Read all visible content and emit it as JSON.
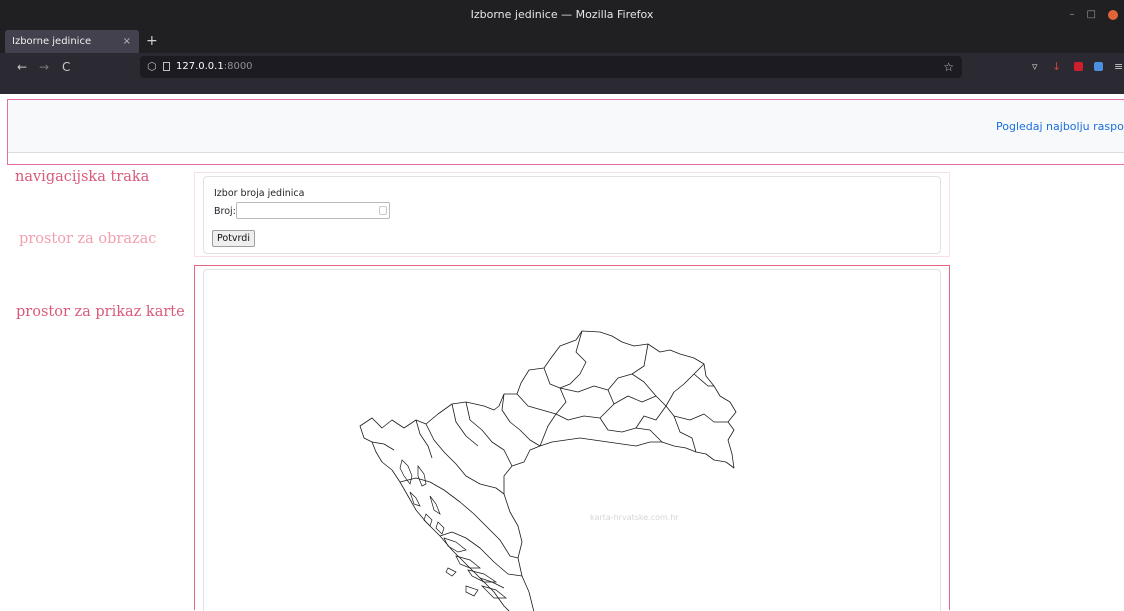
{
  "window": {
    "title": "Izborne jedinice — Mozilla Firefox",
    "minimize": "–",
    "maximize": "□"
  },
  "tab": {
    "title": "Izborne jedinice",
    "close": "×",
    "new_tab": "+"
  },
  "nav": {
    "back": "←",
    "forward": "→",
    "reload": "C",
    "url_host": "127.0.0.1",
    "url_port": ":8000",
    "bookmark": "☆"
  },
  "icons": {
    "shield": "shield-icon",
    "page": "page-icon",
    "pocket": "pocket-icon",
    "download": "download-icon",
    "ublock": "ublock-icon",
    "translate": "translate-icon",
    "menu": "hamburger-menu-icon"
  },
  "colors": {
    "annotation": "#d95a7a",
    "annotation_light": "#f2a0b0",
    "nav_border": "#e66aa4",
    "link": "#1a6fe0"
  },
  "page": {
    "nav_link": "Pogledaj najbolju raspodjelu",
    "annotations": {
      "nav": "navigacijska traka",
      "form": "prostor za obrazac",
      "map": "prostor za prikaz karte"
    },
    "form": {
      "title": "Izbor broja jedinica",
      "label": "Broj:",
      "input_value": "",
      "submit": "Potvrdi"
    },
    "map": {
      "watermark": "karta-hrvatske.com.hr"
    }
  }
}
